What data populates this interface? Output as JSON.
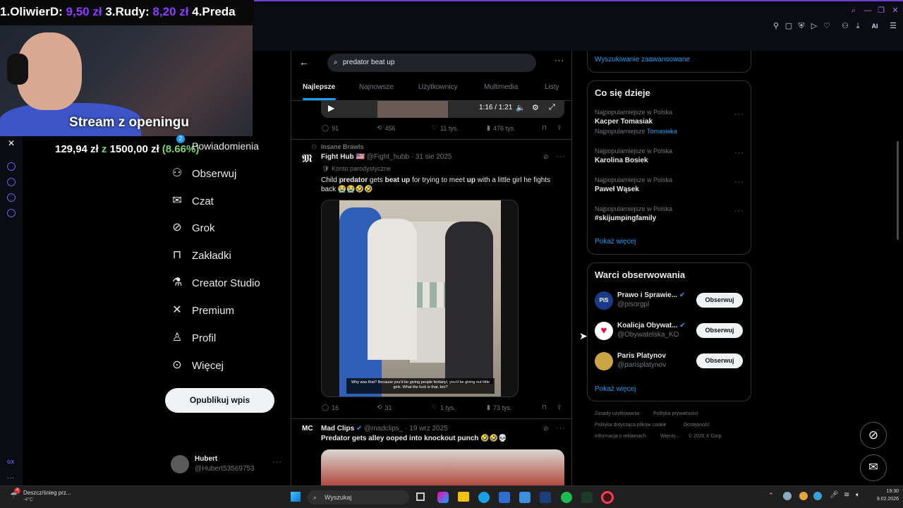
{
  "overlay": {
    "leaderboard": [
      {
        "prefix": "1.",
        "name": "OliwierD:",
        "amount": "9,50 zł"
      },
      {
        "prefix": "3.",
        "name": "Rudy:",
        "amount": "8,20 zł"
      },
      {
        "prefix": "4.",
        "name": "Preda",
        "amount": ""
      }
    ],
    "stream_title": "Stream z openingu",
    "donation": {
      "current": "129,94 zł",
      "sep": "z",
      "goal": "1500,00 zł",
      "percent": "(8.66%)"
    }
  },
  "nav": {
    "notifications_badge": "2",
    "items": [
      {
        "label": "Powiadomienia",
        "icon": "bell-icon"
      },
      {
        "label": "Obserwuj",
        "icon": "add-person-icon"
      },
      {
        "label": "Czat",
        "icon": "mail-icon"
      },
      {
        "label": "Grok",
        "icon": "grok-icon"
      },
      {
        "label": "Zakładki",
        "icon": "bookmark-icon"
      },
      {
        "label": "Creator Studio",
        "icon": "flask-icon"
      },
      {
        "label": "Premium",
        "icon": "x-logo-icon"
      },
      {
        "label": "Profil",
        "icon": "person-icon"
      },
      {
        "label": "Więcej",
        "icon": "more-circle-icon"
      }
    ],
    "publish": "Opublikuj wpis",
    "profile": {
      "name": "Hubert",
      "handle": "@Hubert53569753"
    }
  },
  "search": {
    "query": "predator beat up"
  },
  "tabs": [
    "Najlepsze",
    "Najnowsze",
    "Użytkownicy",
    "Multimedia",
    "Listy"
  ],
  "player": {
    "time": "1:16 / 1:21"
  },
  "first_actions": {
    "replies": "91",
    "reposts": "456",
    "likes": "11 tys.",
    "views": "476 tys."
  },
  "posts": [
    {
      "community": "Insane Brawls",
      "author": "Fight Hub",
      "flag": "🇺🇸",
      "handle": "@Fight_hubb",
      "date": "31 sie 2025",
      "tag": "Konto parodystyczne",
      "text_parts": [
        "Child ",
        "predator",
        " gets ",
        "beat up",
        " for trying to meet ",
        "up",
        " with a little girl he fights back 😭😭🤣🤣"
      ],
      "caption": "Why was that? Because you'd be giving people fentanyl, you'd be giving out little girls. What the fuck is that, bro?",
      "replies": "16",
      "reposts": "31",
      "likes": "1 tys.",
      "views": "73 tys."
    },
    {
      "author": "Mad Clips",
      "handle": "@madclips_",
      "date": "19 wrz 2025",
      "text_parts": [
        "Predator",
        " gets alley ooped into knockout punch 🤣🤣💀"
      ]
    }
  ],
  "right": {
    "advanced_search": "Wyszukiwanie zaawansowane",
    "trends_title": "Co się dzieje",
    "trends": [
      {
        "category": "Najpopularniejsze w Polska",
        "name": "Kacper Tomasiak",
        "extra_prefix": "Najpopularniejsze",
        "extra_link": "Tomasiaka"
      },
      {
        "category": "Najpopularniejsze w Polska",
        "name": "Karolina Bosiek"
      },
      {
        "category": "Najpopularniejsze w Polska",
        "name": "Paweł Wąsek"
      },
      {
        "category": "Najpopularniejsze w Polska",
        "name": "#skijumpingfamily"
      }
    ],
    "show_more": "Pokaż więcej",
    "who_title": "Warci obserwowania",
    "who": [
      {
        "name": "Prawo i Sprawie...",
        "handle": "@pisorgpl",
        "verified": true,
        "avatar_text": "PiS"
      },
      {
        "name": "Koalicja Obywat...",
        "handle": "@Obywatelska_KO",
        "verified": true,
        "avatar_text": "♥"
      },
      {
        "name": "Paris Platynov",
        "handle": "@parisplatynov",
        "verified": false,
        "avatar_text": ""
      }
    ],
    "follow_label": "Obserwuj",
    "footer": [
      "Zasady użytkowania",
      "Polityka prywatności",
      "Polityka dotycząca plików cookie",
      "Dostępność",
      "Informacja o reklamach",
      "Więcej ...",
      "© 2026 X Corp."
    ]
  },
  "taskbar": {
    "weather": "Deszcz/śnieg prz...",
    "temp": "-4°C",
    "weather_badge": "4",
    "search_placeholder": "Wyszukaj",
    "time": "19:30",
    "date": "9.02.2026"
  }
}
